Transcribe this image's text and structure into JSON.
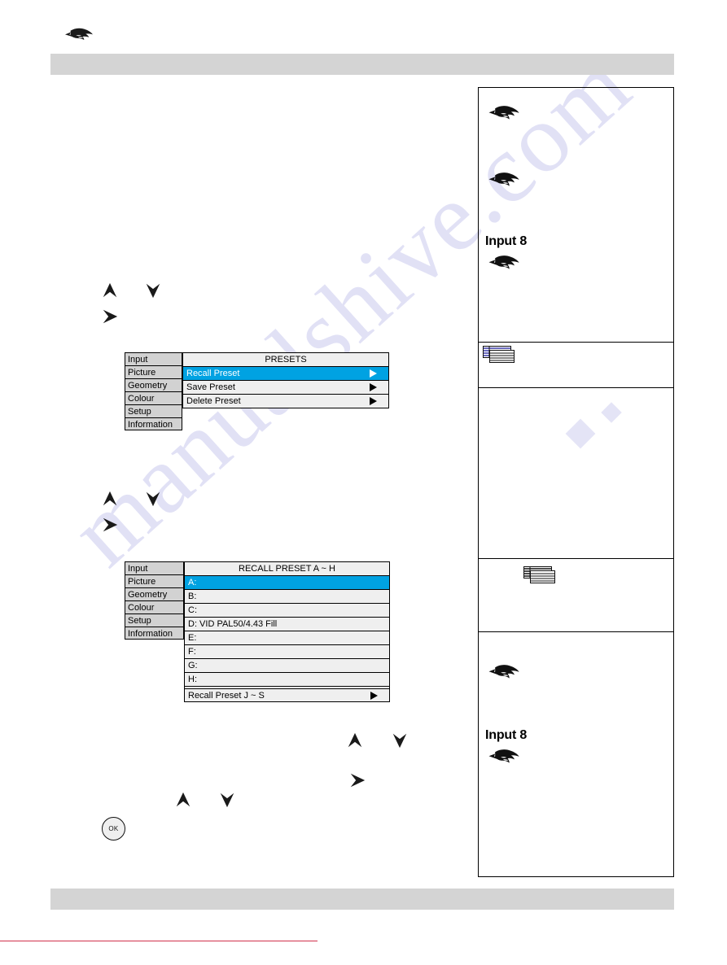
{
  "page": {
    "watermark": "manualshive.com",
    "header_band_color": "#d4d4d4",
    "footer_band_color": "#d4d4d4",
    "accent_color": "#00a2e2",
    "rule_color": "#d0304c"
  },
  "nav_keys": {
    "up": "up-arrow",
    "down": "down-arrow",
    "right": "right-arrow",
    "ok_label": "OK"
  },
  "osd_presets": {
    "menu_items": [
      "Input",
      "Picture",
      "Geometry",
      "Colour",
      "Setup",
      "Information"
    ],
    "title": "PRESETS",
    "rows": [
      {
        "label": "Recall Preset",
        "selected": true,
        "submenu": true
      },
      {
        "label": "Save Preset",
        "selected": false,
        "submenu": true
      },
      {
        "label": "Delete Preset",
        "selected": false,
        "submenu": true
      }
    ]
  },
  "osd_recall": {
    "menu_items": [
      "Input",
      "Picture",
      "Geometry",
      "Colour",
      "Setup",
      "Information"
    ],
    "title": "RECALL PRESET A ~ H",
    "rows": [
      {
        "label": "A:",
        "selected": true,
        "submenu": false
      },
      {
        "label": "B:",
        "selected": false,
        "submenu": false
      },
      {
        "label": "C:",
        "selected": false,
        "submenu": false
      },
      {
        "label": "D: VID PAL50/4.43 Fill",
        "selected": false,
        "submenu": false
      },
      {
        "label": "E:",
        "selected": false,
        "submenu": false
      },
      {
        "label": "F:",
        "selected": false,
        "submenu": false
      },
      {
        "label": "G:",
        "selected": false,
        "submenu": false
      },
      {
        "label": "H:",
        "selected": false,
        "submenu": false
      },
      {
        "label": "Recall Preset J ~ S",
        "selected": false,
        "submenu": true,
        "gap_before": true
      }
    ]
  },
  "notes_panel": {
    "items": [
      {
        "type": "hand",
        "name": "pointing-hand-icon-1"
      },
      {
        "type": "hand",
        "name": "pointing-hand-icon-2"
      },
      {
        "type": "input_label",
        "text": "Input 8"
      },
      {
        "type": "hand",
        "name": "pointing-hand-icon-3"
      },
      {
        "type": "table",
        "name": "table-icon-1"
      },
      {
        "type": "table",
        "name": "table-icon-2"
      },
      {
        "type": "hand",
        "name": "pointing-hand-icon-4"
      },
      {
        "type": "input_label",
        "text": "Input 8"
      },
      {
        "type": "hand",
        "name": "pointing-hand-icon-5"
      }
    ],
    "input_label_top": "Input 8",
    "input_label_bottom": "Input 8"
  }
}
